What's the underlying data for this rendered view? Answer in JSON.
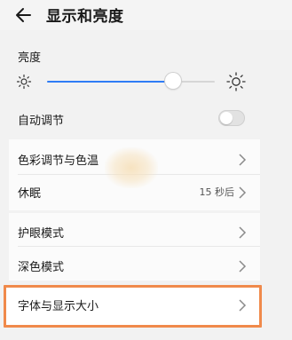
{
  "header": {
    "title": "显示和亮度",
    "back_icon": "arrow-left-icon"
  },
  "brightness": {
    "title": "亮度",
    "value_fraction": 0.75,
    "min_icon": "sun-small-icon",
    "max_icon": "sun-large-icon",
    "accent_color": "#2f7cf6"
  },
  "auto_adjust": {
    "label": "自动调节",
    "enabled": false
  },
  "items": [
    {
      "label": "色彩调节与色温"
    },
    {
      "label": "休眠",
      "value": "15 秒后"
    },
    {
      "label": "护眼模式"
    },
    {
      "label": "深色模式"
    },
    {
      "label": "字体与显示大小",
      "highlighted": true
    }
  ],
  "highlight_color": "#f08a4b"
}
